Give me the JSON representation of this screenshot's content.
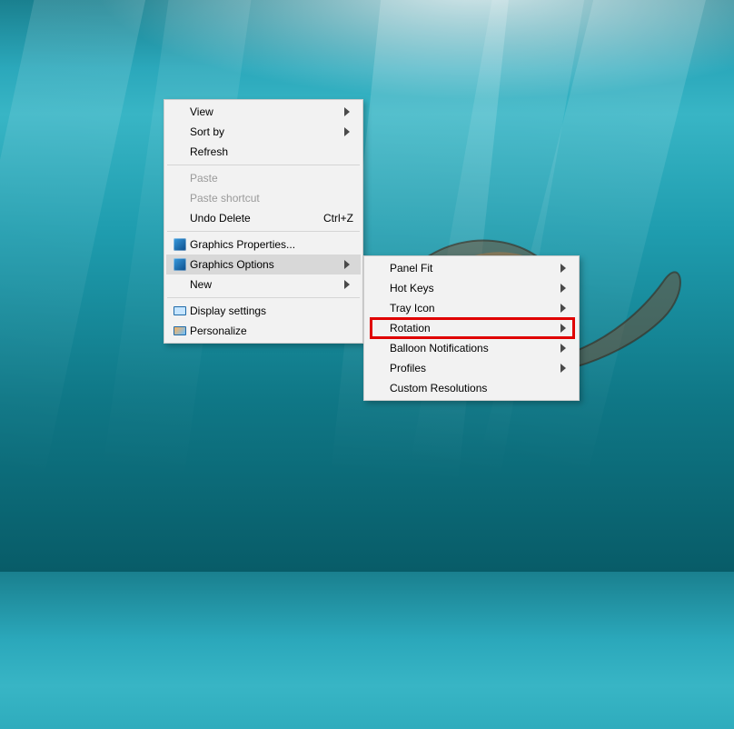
{
  "main_menu": {
    "view": {
      "label": "View",
      "arrow": true
    },
    "sort_by": {
      "label": "Sort by",
      "arrow": true
    },
    "refresh": {
      "label": "Refresh",
      "arrow": false
    },
    "paste": {
      "label": "Paste",
      "arrow": false,
      "disabled": true
    },
    "paste_shortcut": {
      "label": "Paste shortcut",
      "arrow": false,
      "disabled": true
    },
    "undo_delete": {
      "label": "Undo Delete",
      "shortcut": "Ctrl+Z"
    },
    "gfx_props": {
      "label": "Graphics Properties..."
    },
    "gfx_options": {
      "label": "Graphics Options",
      "arrow": true,
      "hover": true
    },
    "new": {
      "label": "New",
      "arrow": true
    },
    "display_settings": {
      "label": "Display settings"
    },
    "personalize": {
      "label": "Personalize"
    }
  },
  "sub_menu": {
    "panel_fit": {
      "label": "Panel Fit",
      "arrow": true
    },
    "hot_keys": {
      "label": "Hot Keys",
      "arrow": true
    },
    "tray_icon": {
      "label": "Tray Icon",
      "arrow": true
    },
    "rotation": {
      "label": "Rotation",
      "arrow": true
    },
    "balloon": {
      "label": "Balloon Notifications",
      "arrow": true
    },
    "profiles": {
      "label": "Profiles",
      "arrow": true
    },
    "custom_res": {
      "label": "Custom Resolutions"
    }
  }
}
